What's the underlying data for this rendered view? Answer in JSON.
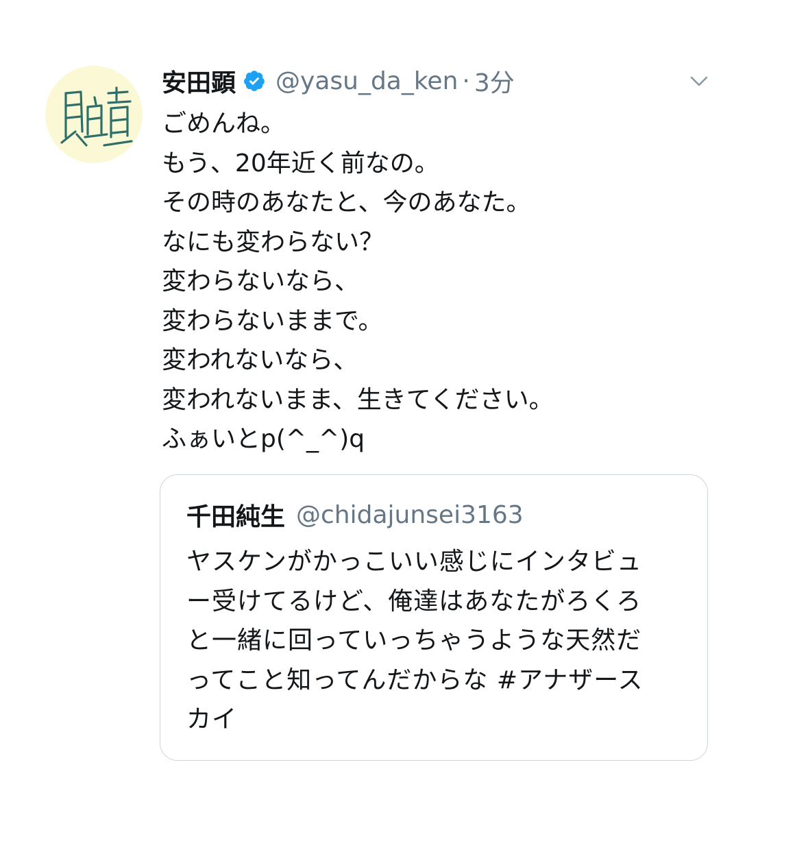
{
  "tweet": {
    "author": {
      "display_name": "安田顕",
      "handle": "@yasu_da_ken",
      "avatar_icon": "calligraphy-avatar-icon",
      "verified_icon": "verified-badge-icon"
    },
    "separator": "·",
    "time": "3分",
    "menu_icon": "chevron-down-icon",
    "lines": [
      "ごめんね。",
      "もう、20年近く前なの。",
      "その時のあなたと、今のあなた。",
      "なにも変わらない？",
      "変わらないなら、",
      "変わらないままで。",
      "変われないなら、",
      "変われないまま、生きてください。",
      "ふぁいとp(^_^)q"
    ]
  },
  "quoted_tweet": {
    "display_name": "千田純生",
    "handle": "@chidajunsei3163",
    "lines": [
      "ヤスケンがかっこいい感じにインタビュ",
      "ー受けてるけど、俺達はあなたがろくろ",
      "と一緒に回っていっちゃうような天然だ",
      "ってこと知ってんだからな #アナザース",
      "カイ"
    ]
  },
  "colors": {
    "text": "#14171a",
    "secondary_text": "#657786",
    "verified_blue": "#1da1f2",
    "card_border": "#ccd6dd",
    "avatar_bg": "#fbf8d6",
    "avatar_ink": "#2f6f6a"
  }
}
